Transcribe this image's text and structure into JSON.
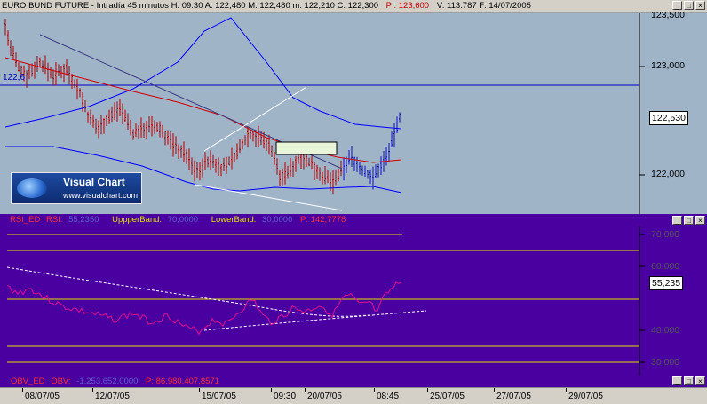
{
  "window": {
    "title": "EURO BUND FUTURE - Intradía 45 minutos H: 09:30  A: 122,480  M: 122,480  m: 122,210  C: 122,300",
    "title_p": "P : 123,600",
    "title_rest": "V: 113.787  F: 14/07/2005"
  },
  "price_pane": {
    "y_labels": [
      "123,500",
      "123,000",
      "122,000"
    ],
    "current_price": "122,530",
    "left_price_label": "122,6",
    "logo": {
      "title": "Visual Chart",
      "url": "www.visualchart.com"
    }
  },
  "rsi_pane": {
    "header_name": "RSI_ED",
    "header_rsi_label": "RSI:",
    "header_rsi_value": "55,2350",
    "header_upper_label": "UppperBand:",
    "header_upper_value": "70,0000",
    "header_lower_label": "LowerBand:",
    "header_lower_value": "30,0000",
    "header_p": "P: 142,7778",
    "y_labels": [
      "70,000",
      "60,000",
      "40,000",
      "30,000"
    ],
    "current_value": "55,235"
  },
  "obv_pane": {
    "header_name": "OBV_ED",
    "header_obv_label": "OBV:",
    "header_obv_value": "-1.253.652,0000",
    "header_p": "P: 86.980.407,8571"
  },
  "x_axis": {
    "labels": [
      "08/07/05",
      "12/07/05",
      "15/07/05",
      "09:30",
      "20/07/05",
      "08:45",
      "25/07/05",
      "27/07/05",
      "29/07/05"
    ]
  },
  "colors": {
    "price_bg": "#a0b4c8",
    "rsi_bg": "#4a00a0",
    "price_bars": "#b00000",
    "recent_bars": "#1010c0",
    "bands": "#0000ff",
    "ma": "#d00000",
    "rsi_line": "#e01090",
    "band_lines": "#d4d400"
  }
}
